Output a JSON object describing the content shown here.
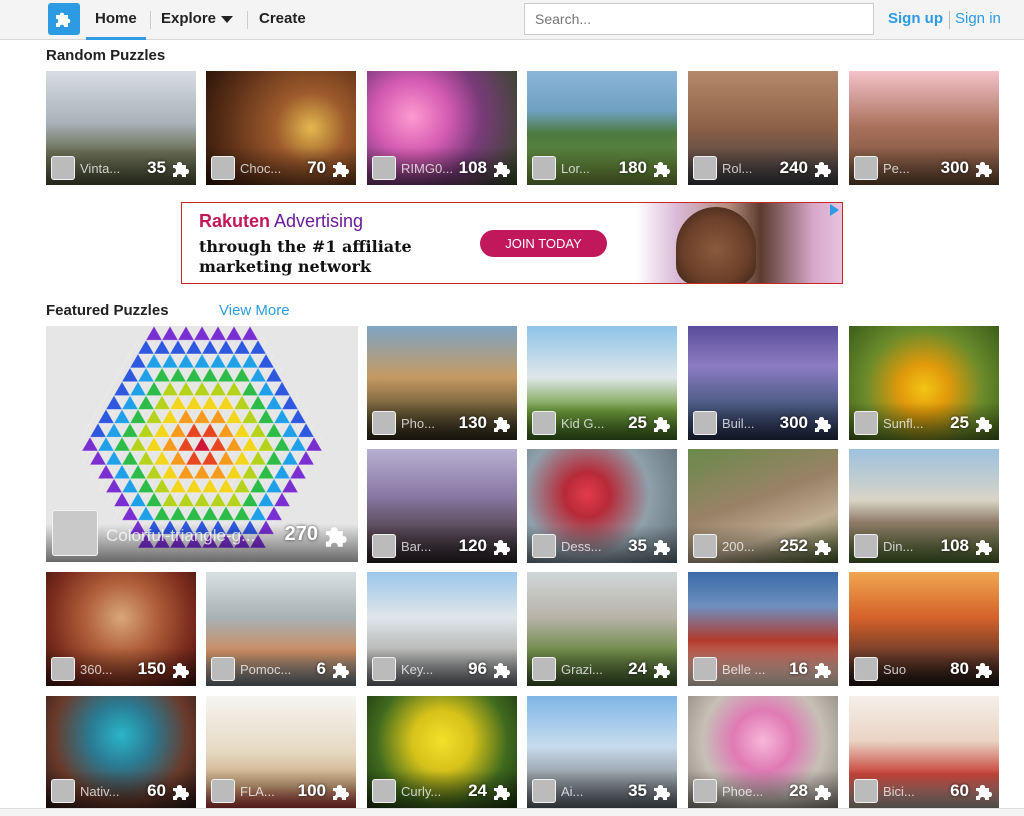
{
  "header": {
    "nav": {
      "home": "Home",
      "explore": "Explore",
      "create": "Create"
    },
    "search_placeholder": "Search...",
    "signup": "Sign up",
    "signin": "Sign in",
    "accent": "#2d9be4"
  },
  "random": {
    "title": "Random Puzzles",
    "tiles": [
      {
        "name": "Vinta...",
        "count": "35"
      },
      {
        "name": "Choc...",
        "count": "70"
      },
      {
        "name": "RIMG0...",
        "count": "108"
      },
      {
        "name": "Lor...",
        "count": "180"
      },
      {
        "name": "Rol...",
        "count": "240"
      },
      {
        "name": "Pe...",
        "count": "300"
      }
    ]
  },
  "ad": {
    "brand_a": "Rakuten",
    "brand_b": " Advertising",
    "line1": "through the #1 affiliate",
    "line2": "marketing network",
    "cta": "JOIN TODAY"
  },
  "featured": {
    "title": "Featured Puzzles",
    "view_more": "View More",
    "big": {
      "name": "Colorful-triangle-g...",
      "count": "270"
    },
    "tiles": [
      {
        "name": "Pho...",
        "count": "130"
      },
      {
        "name": "Kid G...",
        "count": "25"
      },
      {
        "name": "Buil...",
        "count": "300"
      },
      {
        "name": "Sunfl...",
        "count": "25"
      },
      {
        "name": "Bar...",
        "count": "120"
      },
      {
        "name": "Dess...",
        "count": "35"
      },
      {
        "name": "200...",
        "count": "252"
      },
      {
        "name": "Din...",
        "count": "108"
      },
      {
        "name": "360...",
        "count": "150"
      },
      {
        "name": "Pomoc...",
        "count": "6"
      },
      {
        "name": "Key...",
        "count": "96"
      },
      {
        "name": "Grazi...",
        "count": "24"
      },
      {
        "name": "Belle ...",
        "count": "16"
      },
      {
        "name": "Suo",
        "count": "80"
      },
      {
        "name": "Nativ...",
        "count": "60"
      },
      {
        "name": "FLA...",
        "count": "100"
      },
      {
        "name": "Curly...",
        "count": "24"
      },
      {
        "name": "Ai...",
        "count": "35"
      },
      {
        "name": "Phoe...",
        "count": "28"
      },
      {
        "name": "Bici...",
        "count": "60"
      }
    ]
  }
}
